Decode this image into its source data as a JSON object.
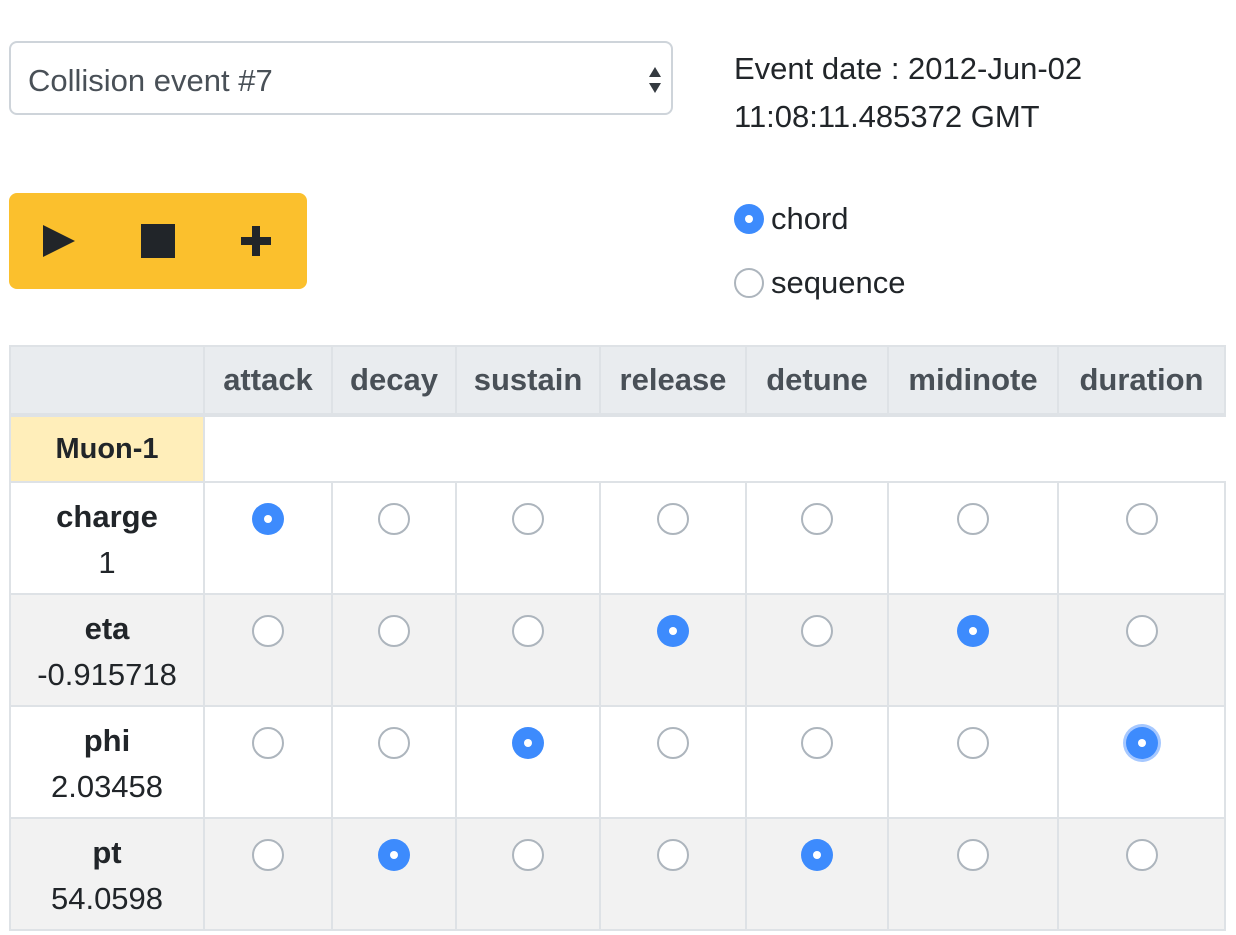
{
  "event_select": {
    "value": "Collision event #7"
  },
  "event_date": {
    "line1": "Event date : 2012-Jun-02",
    "line2": "11:08:11.485372 GMT"
  },
  "controls": {
    "play_icon": "play-icon",
    "stop_icon": "stop-icon",
    "add_icon": "plus-icon",
    "background_color": "#fbc02d"
  },
  "mode": {
    "options": [
      {
        "label": "chord",
        "selected": true
      },
      {
        "label": "sequence",
        "selected": false
      }
    ]
  },
  "table": {
    "columns": [
      "attack",
      "decay",
      "sustain",
      "release",
      "detune",
      "midinote",
      "duration"
    ],
    "group": "Muon-1",
    "rows": [
      {
        "name": "charge",
        "value": "1",
        "selected": [
          "attack"
        ]
      },
      {
        "name": "eta",
        "value": "-0.915718",
        "selected": [
          "release",
          "midinote"
        ]
      },
      {
        "name": "phi",
        "value": "2.03458",
        "selected": [
          "sustain",
          "duration"
        ]
      },
      {
        "name": "pt",
        "value": "54.0598",
        "selected": [
          "decay",
          "detune"
        ]
      }
    ]
  },
  "colors": {
    "accent": "#3d8bfd",
    "group_header": "#ffeeba",
    "header_bg": "#e9ecef"
  }
}
